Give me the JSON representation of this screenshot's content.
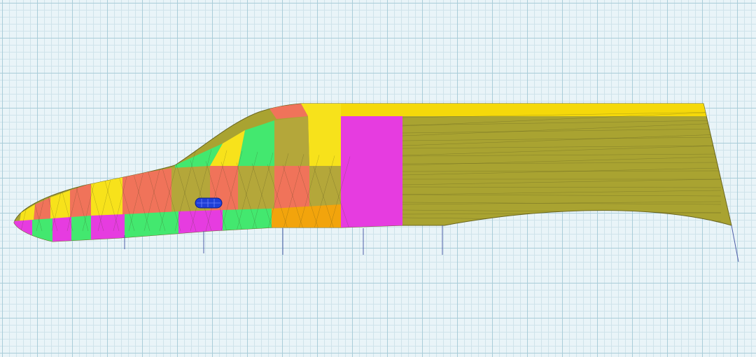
{
  "viewport": {
    "background": "#e9f4f8",
    "grid_major_color": "#a9cdd9",
    "grid_minor_color": "#cfe3ea"
  },
  "model": {
    "colors": {
      "body": "#a9a331",
      "roof_band": "#f5d90a",
      "magenta": "#e63ce0",
      "yellow": "#f7e21b",
      "salmon": "#f0735a",
      "green": "#43e86f",
      "orange": "#f2a40c",
      "olive": "#b4a73a",
      "window": "#1f3fd8"
    },
    "icons": [
      "window-mesh-icon"
    ]
  }
}
